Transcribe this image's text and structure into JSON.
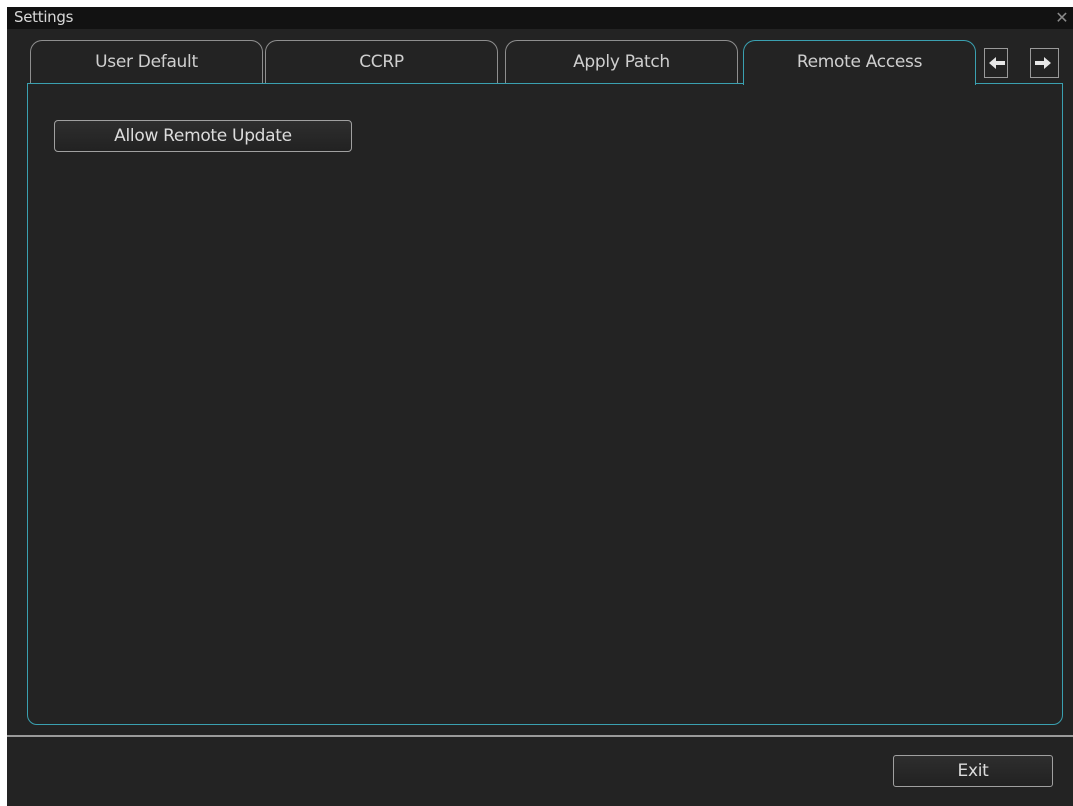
{
  "window": {
    "title": "Settings",
    "close_icon": "close-icon"
  },
  "tabs": [
    {
      "label": "User Default",
      "active": false
    },
    {
      "label": "CCRP",
      "active": false
    },
    {
      "label": "Apply Patch",
      "active": false
    },
    {
      "label": "Remote Access",
      "active": true
    }
  ],
  "tab_scroll": {
    "left_icon": "arrow-left-icon",
    "right_icon": "arrow-right-icon"
  },
  "remote_access": {
    "allow_remote_update_label": "Allow Remote Update"
  },
  "footer": {
    "exit_label": "Exit"
  },
  "colors": {
    "background": "#232323",
    "titlebar": "#121212",
    "accent": "#3aa0b0",
    "text": "#d8d8d8",
    "border": "#9a9a9a"
  }
}
